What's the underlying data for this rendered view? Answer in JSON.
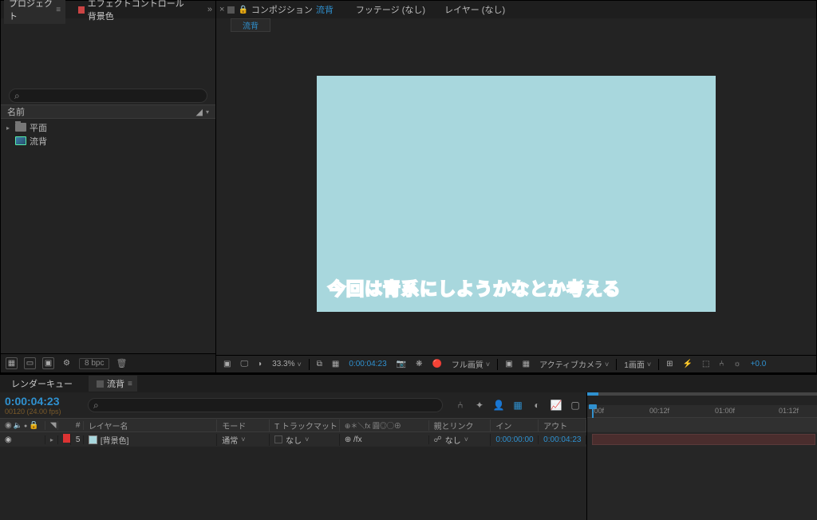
{
  "project_panel": {
    "tab_project": "プロジェクト",
    "tab_effect_controls": "エフェクトコントロール 背景色",
    "search_placeholder": "",
    "col_name": "名前",
    "tree": {
      "folder": "平面",
      "comp": "流背"
    },
    "bpc": "8 bpc"
  },
  "comp_panel": {
    "tab_composition_prefix": "コンポジション",
    "tab_composition_name": "流背",
    "tab_footage": "フッテージ (なし)",
    "tab_layer": "レイヤー (なし)",
    "sub_tab": "流背",
    "caption": "今回は青系にしようかなとか考える",
    "footer": {
      "zoom": "33.3%",
      "time": "0:00:04:23",
      "quality": "フル画質",
      "camera": "アクティブカメラ",
      "views": "1画面",
      "exposure": "+0.0"
    }
  },
  "timeline": {
    "tab_render_queue": "レンダーキュー",
    "tab_comp": "流背",
    "timecode": "0:00:04:23",
    "timecode_sub": "00120 (24.00 fps)",
    "search_placeholder": "",
    "cols": {
      "num": "#",
      "layer_name": "レイヤー名",
      "mode": "モード",
      "trackmatte_prefix": "T",
      "trackmatte": "トラックマット",
      "switches": "⊕＊＼fx 圓◎◯⊕",
      "parent": "親とリンク",
      "in": "イン",
      "out": "アウト"
    },
    "layer": {
      "index": "5",
      "name": "[背景色]",
      "mode": "通常",
      "trackmatte": "なし",
      "fx_cell": "⊕   /fx",
      "parent": "なし",
      "in": "0:00:00:00",
      "out": "0:00:04:23"
    },
    "ruler": {
      "t0": ":00f",
      "t1": "00:12f",
      "t2": "01:00f",
      "t3": "01:12f"
    }
  }
}
